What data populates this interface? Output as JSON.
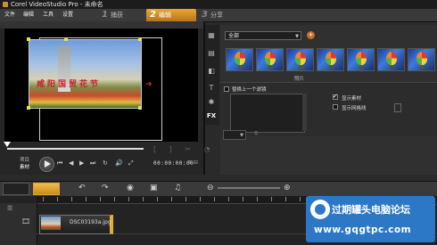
{
  "window": {
    "title": "Corel VideoStudio Pro - 未命名"
  },
  "menu": [
    "文件",
    "编辑",
    "工具",
    "设置"
  ],
  "steps": [
    {
      "num": "1",
      "label": "捕获"
    },
    {
      "num": "2",
      "label": "编辑"
    },
    {
      "num": "3",
      "label": "分享"
    }
  ],
  "preview": {
    "caption": "咸阳国贸花节",
    "mode_project": "项目",
    "mode_clip": "素材",
    "timecode": "00:00:00:00"
  },
  "library": {
    "category": "全部",
    "thumbnail_count": 7,
    "thumb_label": "照片",
    "replace_filter": "替换上一个滤镜",
    "show_clips": "显示素材",
    "show_grid": "显示网格线",
    "show_clips_checked": true,
    "show_grid_checked": false
  },
  "timeline": {
    "clip_name": "DSC03193a.jpg"
  },
  "watermark": {
    "title": "过期罐头电脑论坛",
    "url": "www.gqgtpc.com"
  },
  "colors": {
    "accent": "#e4a535",
    "watermark_bg": "#2c78c7"
  }
}
